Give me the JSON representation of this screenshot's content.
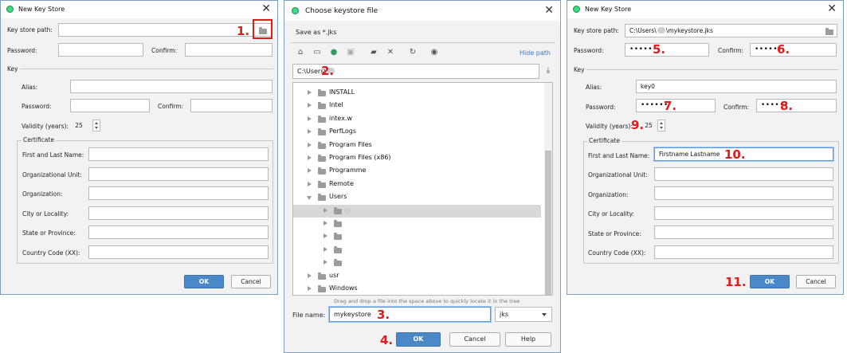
{
  "dialog1": {
    "title": "New Key Store",
    "keystore_path_label": "Key store path:",
    "keystore_path_value": "",
    "password_label": "Password:",
    "confirm_label": "Confirm:",
    "key_section": "Key",
    "alias_label": "Alias:",
    "key_password_label": "Password:",
    "key_confirm_label": "Confirm:",
    "validity_label": "Validity (years):",
    "validity_value": "25",
    "certificate_title": "Certificate",
    "first_last_label": "First and Last Name:",
    "org_unit_label": "Organizational Unit:",
    "organization_label": "Organization:",
    "city_label": "City or Locality:",
    "state_label": "State or Province:",
    "country_label": "Country Code (XX):",
    "ok_label": "OK",
    "cancel_label": "Cancel",
    "step1": "1."
  },
  "dialog2": {
    "title": "Choose keystore file",
    "save_as": "Save as *.jks",
    "hide_path": "Hide path",
    "path_value": "C:\\Users\\",
    "step2": "2.",
    "tree": [
      {
        "name": "INSTALL",
        "expanded": false
      },
      {
        "name": "Intel",
        "expanded": false
      },
      {
        "name": "intex.w",
        "expanded": false
      },
      {
        "name": "PerfLogs",
        "expanded": false
      },
      {
        "name": "Program Files",
        "expanded": false
      },
      {
        "name": "Program Files (x86)",
        "expanded": false
      },
      {
        "name": "Programme",
        "expanded": false
      },
      {
        "name": "Remote",
        "expanded": false
      },
      {
        "name": "Users",
        "expanded": true
      },
      {
        "name": "",
        "expanded": false,
        "child": true,
        "selected": true
      },
      {
        "name": "",
        "expanded": false,
        "child": true
      },
      {
        "name": "",
        "expanded": false,
        "child": true
      },
      {
        "name": "",
        "expanded": false,
        "child": true
      },
      {
        "name": "",
        "expanded": false,
        "child": true
      },
      {
        "name": "usr",
        "expanded": false
      },
      {
        "name": "Windows",
        "expanded": false
      }
    ],
    "drag_hint": "Drag and drop a file into the space above to quickly locate it in the tree",
    "file_name_label": "File name:",
    "file_name_value": "mykeystore",
    "file_type": "jks",
    "step3": "3.",
    "step4": "4.",
    "ok_label": "OK",
    "cancel_label": "Cancel",
    "help_label": "Help"
  },
  "dialog3": {
    "title": "New Key Store",
    "keystore_path_label": "Key store path:",
    "keystore_path_prefix": "C:\\Users\\",
    "keystore_path_suffix": "\\mykeystore.jks",
    "password_label": "Password:",
    "password_value": "••••••",
    "confirm_label": "Confirm:",
    "confirm_value": "••••••",
    "key_section": "Key",
    "alias_label": "Alias:",
    "alias_value": "key0",
    "key_password_label": "Password:",
    "key_password_value": "••••••",
    "key_confirm_label": "Confirm:",
    "key_confirm_value": "••••••",
    "validity_label": "Validity (years):",
    "validity_value": "25",
    "certificate_title": "Certificate",
    "first_last_label": "First and Last Name:",
    "first_last_value": "Firstname Lastname",
    "org_unit_label": "Organizational Unit:",
    "organization_label": "Organization:",
    "city_label": "City or Locality:",
    "state_label": "State or Province:",
    "country_label": "Country Code (XX):",
    "ok_label": "OK",
    "cancel_label": "Cancel",
    "step5": "5.",
    "step6": "6.",
    "step7": "7.",
    "step8": "8.",
    "step9": "9.",
    "step10": "10.",
    "step11": "11."
  },
  "colors": {
    "step_marker": "#e11a1a",
    "primary_button": "#4a88c7",
    "link": "#3877c7",
    "android_icon": "#3ddc84"
  }
}
